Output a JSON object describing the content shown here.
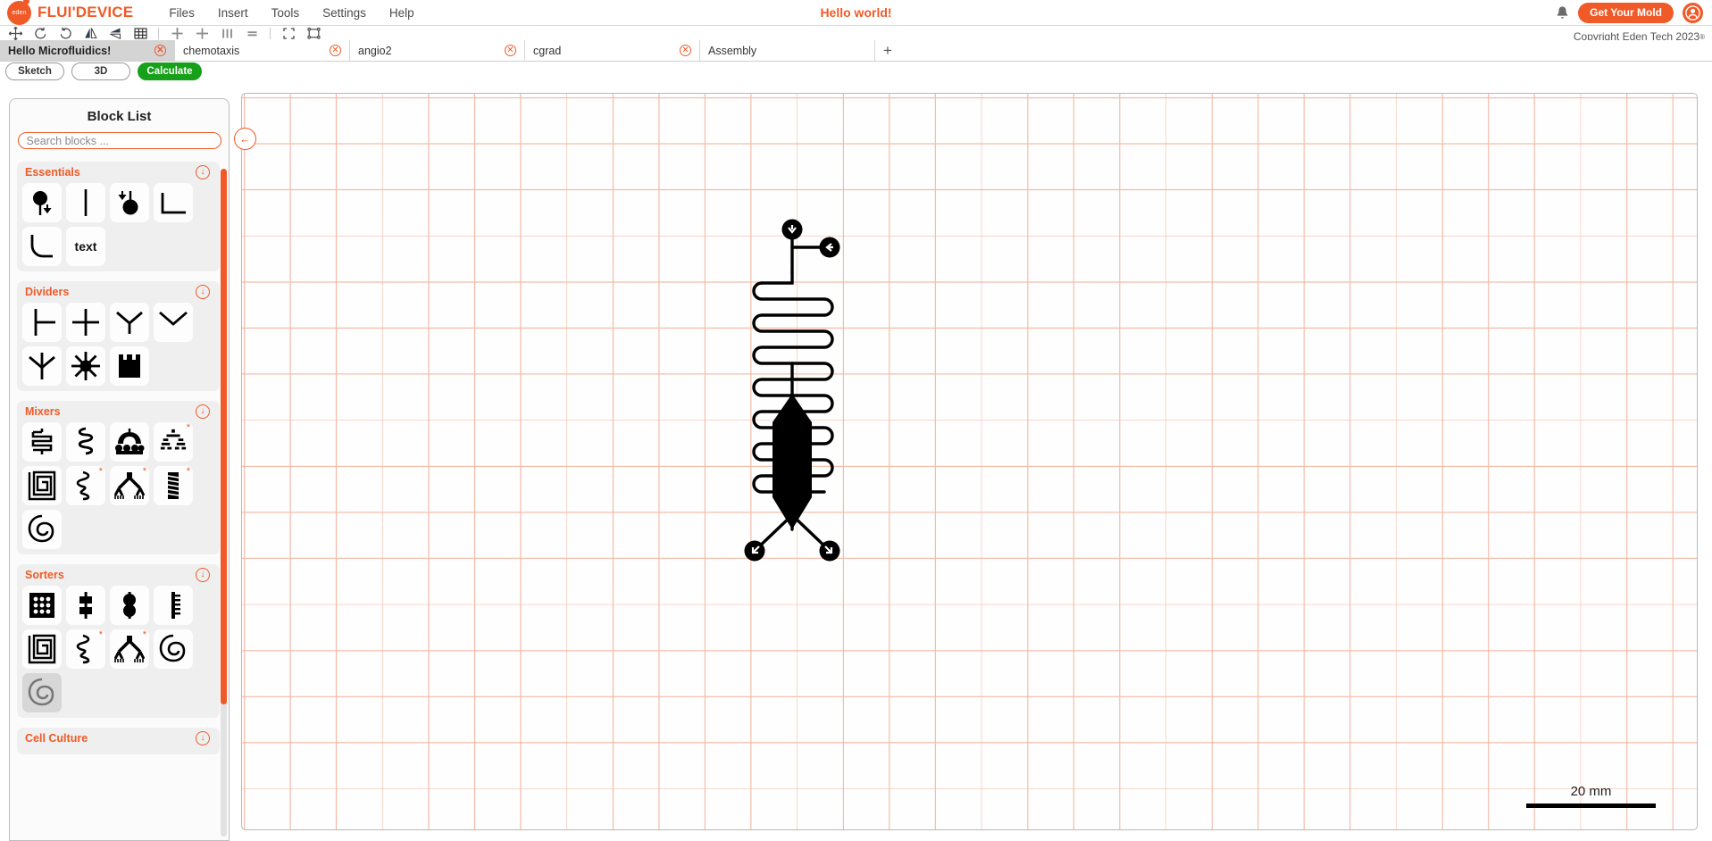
{
  "header": {
    "brand": "FLUI'DEVICE",
    "logo_text": "eden",
    "menus": [
      {
        "label": "Files"
      },
      {
        "label": "Insert"
      },
      {
        "label": "Tools"
      },
      {
        "label": "Settings"
      },
      {
        "label": "Help"
      }
    ],
    "center_title": "Hello world!",
    "mold_button": "Get Your Mold",
    "notification_icon": "bell-icon",
    "avatar_icon": "user-avatar-icon"
  },
  "toolbar": {
    "tools": [
      {
        "name": "move-icon"
      },
      {
        "name": "rotate-left-icon"
      },
      {
        "name": "rotate-right-icon"
      },
      {
        "name": "mirror-vertical-icon"
      },
      {
        "name": "mirror-horizontal-icon"
      },
      {
        "name": "grid-icon"
      },
      {
        "name": "align-center-vertical-icon"
      },
      {
        "name": "align-center-horizontal-icon"
      },
      {
        "name": "distribute-horizontal-icon"
      },
      {
        "name": "distribute-vertical-icon"
      },
      {
        "name": "select-area-icon"
      },
      {
        "name": "bounding-box-icon"
      }
    ],
    "copyright": "Copyright Eden Tech 2023",
    "copyright_mark": "®"
  },
  "tabs": {
    "items": [
      {
        "label": "Hello Microfluidics!",
        "active": true,
        "closable": true
      },
      {
        "label": "chemotaxis",
        "active": false,
        "closable": true
      },
      {
        "label": "angio2",
        "active": false,
        "closable": true
      },
      {
        "label": "cgrad",
        "active": false,
        "closable": true
      },
      {
        "label": "Assembly",
        "active": false,
        "closable": false
      }
    ],
    "add_label": "+"
  },
  "modes": {
    "sketch": "Sketch",
    "three_d": "3D",
    "calculate": "Calculate",
    "calculate_color": "#17a11a"
  },
  "sidebar": {
    "title": "Block List",
    "search_placeholder": "Search blocks ...",
    "collapse_icon": "arrow-left-circle-icon",
    "accent_color": "#f05a28",
    "categories": [
      {
        "name": "Essentials",
        "toggle_icon": "chevron-down-circle-icon",
        "blocks": [
          {
            "icon": "inlet-block",
            "starred": false,
            "selected": false
          },
          {
            "icon": "straight-channel-block",
            "starred": false,
            "selected": false
          },
          {
            "icon": "outlet-block",
            "starred": false,
            "selected": false
          },
          {
            "icon": "corner-block",
            "starred": false,
            "selected": false
          },
          {
            "icon": "curve-block",
            "starred": false,
            "selected": false
          },
          {
            "icon": "text-block",
            "label": "text",
            "starred": false,
            "selected": false
          }
        ]
      },
      {
        "name": "Dividers",
        "toggle_icon": "chevron-down-circle-icon",
        "blocks": [
          {
            "icon": "t-junction-block",
            "starred": false,
            "selected": false
          },
          {
            "icon": "cross-junction-block",
            "starred": false,
            "selected": false
          },
          {
            "icon": "y-junction-block",
            "starred": false,
            "selected": false
          },
          {
            "icon": "y-split-block",
            "starred": false,
            "selected": false
          },
          {
            "icon": "trident-block",
            "starred": false,
            "selected": false
          },
          {
            "icon": "star-manifold-block",
            "starred": false,
            "selected": false
          },
          {
            "icon": "comb-manifold-block",
            "starred": false,
            "selected": false
          }
        ]
      },
      {
        "name": "Mixers",
        "toggle_icon": "chevron-down-circle-icon",
        "blocks": [
          {
            "icon": "square-serpentine-block",
            "starred": false,
            "selected": false
          },
          {
            "icon": "wave-serpentine-block",
            "starred": false,
            "selected": false
          },
          {
            "icon": "tree-mixer-block",
            "starred": false,
            "selected": false
          },
          {
            "icon": "fractal-mixer-block",
            "starred": true,
            "selected": false
          },
          {
            "icon": "spiral-square-block",
            "starred": false,
            "selected": false
          },
          {
            "icon": "zigzag-block",
            "starred": true,
            "selected": false
          },
          {
            "icon": "branching-tree-block",
            "starred": true,
            "selected": false
          },
          {
            "icon": "herringbone-block",
            "starred": true,
            "selected": false
          },
          {
            "icon": "spiral-round-block",
            "starred": false,
            "selected": false
          }
        ]
      },
      {
        "name": "Sorters",
        "toggle_icon": "chevron-down-circle-icon",
        "blocks": [
          {
            "icon": "pillar-array-block",
            "starred": false,
            "selected": false
          },
          {
            "icon": "chamber-pair-block",
            "starred": false,
            "selected": false
          },
          {
            "icon": "bead-chamber-block",
            "starred": false,
            "selected": false
          },
          {
            "icon": "ladder-filter-block",
            "starred": false,
            "selected": false
          },
          {
            "icon": "spiral-square-block",
            "starred": false,
            "selected": false
          },
          {
            "icon": "zigzag-block",
            "starred": true,
            "selected": false
          },
          {
            "icon": "branching-tree-block",
            "starred": true,
            "selected": false
          },
          {
            "icon": "spiral-round-block",
            "starred": false,
            "selected": false
          },
          {
            "icon": "spiral-round-block",
            "starred": false,
            "selected": true
          }
        ]
      },
      {
        "name": "Cell Culture",
        "toggle_icon": "chevron-down-circle-icon",
        "blocks": []
      }
    ]
  },
  "canvas": {
    "scale_label": "20 mm",
    "grid_color": "#f3b9a4",
    "circuit": {
      "inlet_top_icon": "inlet-arrow-down",
      "inlet_side_icon": "inlet-arrow-left",
      "outlet_left_icon": "outlet-arrow-down-left",
      "outlet_right_icon": "outlet-arrow-down-right",
      "serpentine_turns": 7,
      "chamber": "hexagonal-chamber"
    }
  }
}
